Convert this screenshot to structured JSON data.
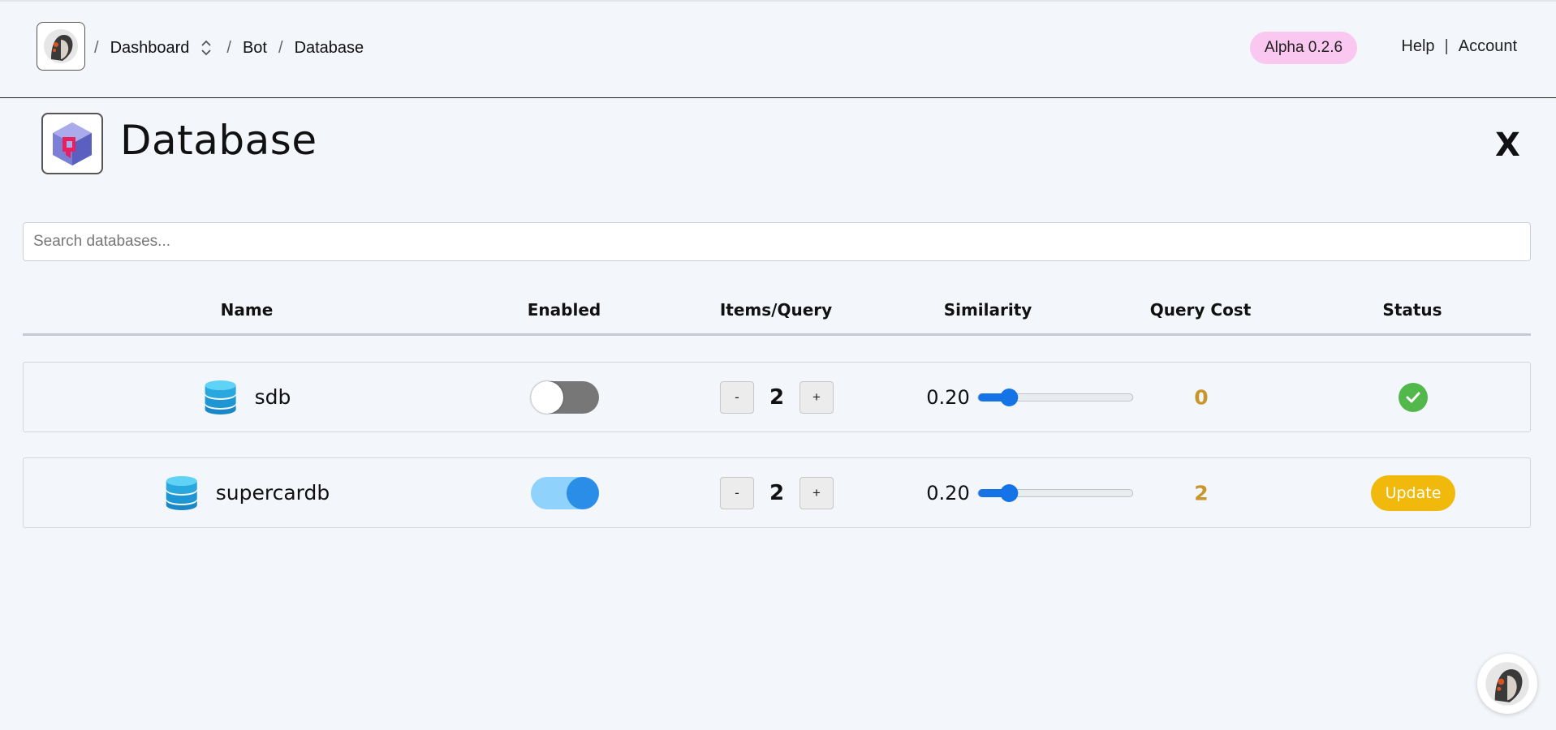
{
  "breadcrumb": {
    "items": [
      "Dashboard",
      "Bot",
      "Database"
    ],
    "separator": "/"
  },
  "version_badge": "Alpha 0.2.6",
  "top_links": {
    "help": "Help",
    "separator": "|",
    "account": "Account"
  },
  "page": {
    "title": "Database",
    "close_label": "X"
  },
  "search": {
    "placeholder": "Search databases...",
    "value": ""
  },
  "table": {
    "columns": [
      "Name",
      "Enabled",
      "Items/Query",
      "Similarity",
      "Query Cost",
      "Status"
    ],
    "rows": [
      {
        "name": "sdb",
        "enabled": false,
        "items_per_query": "2",
        "similarity": "0.20",
        "similarity_fraction": 0.2,
        "query_cost": "0",
        "status": "ok",
        "status_label": ""
      },
      {
        "name": "supercardb",
        "enabled": true,
        "items_per_query": "2",
        "similarity": "0.20",
        "similarity_fraction": 0.2,
        "query_cost": "2",
        "status": "update",
        "status_label": "Update"
      }
    ],
    "stepper": {
      "minus": "-",
      "plus": "+"
    }
  },
  "colors": {
    "accent": "#1473e6",
    "toggle_on": "#2a8de8",
    "cost": "#c8962a",
    "update": "#f0b90c",
    "ok": "#52b84b",
    "badge": "#f9c7ef"
  }
}
